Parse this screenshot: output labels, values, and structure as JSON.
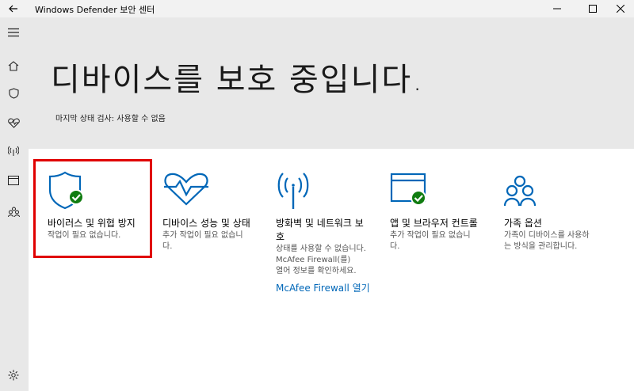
{
  "window": {
    "title": "Windows Defender 보안 센터"
  },
  "hero": {
    "title": "디바이스를 보호 중입니다.",
    "subtitle": "마지막 상태 검사: 사용할 수 없음"
  },
  "cards": [
    {
      "title": "바이러스 및 위협 방지",
      "desc": "작업이 필요 없습니다."
    },
    {
      "title": "디바이스 성능 및 상태",
      "desc_line1": "추가 작업이 필요 없습니",
      "desc_line2": "다."
    },
    {
      "title_line1": "방화벽 및 네트워크 보",
      "title_line2": "호",
      "desc_line1": "상태를 사용할 수 없습니다.",
      "desc_line2": "McAfee Firewall(를)",
      "desc_line3": "열어 정보를 확인하세요.",
      "link": "McAfee Firewall 열기"
    },
    {
      "title": "앱 및 브라우저 컨트롤",
      "desc_line1": "추가 작업이 필요 없습니",
      "desc_line2": "다."
    },
    {
      "title": "가족 옵션",
      "desc_line1": "가족이 디바이스를 사용하",
      "desc_line2": "는 방식을 관리합니다."
    }
  ],
  "colors": {
    "accent": "#0067b8",
    "ok": "#107c10",
    "highlight": "#e00000"
  }
}
